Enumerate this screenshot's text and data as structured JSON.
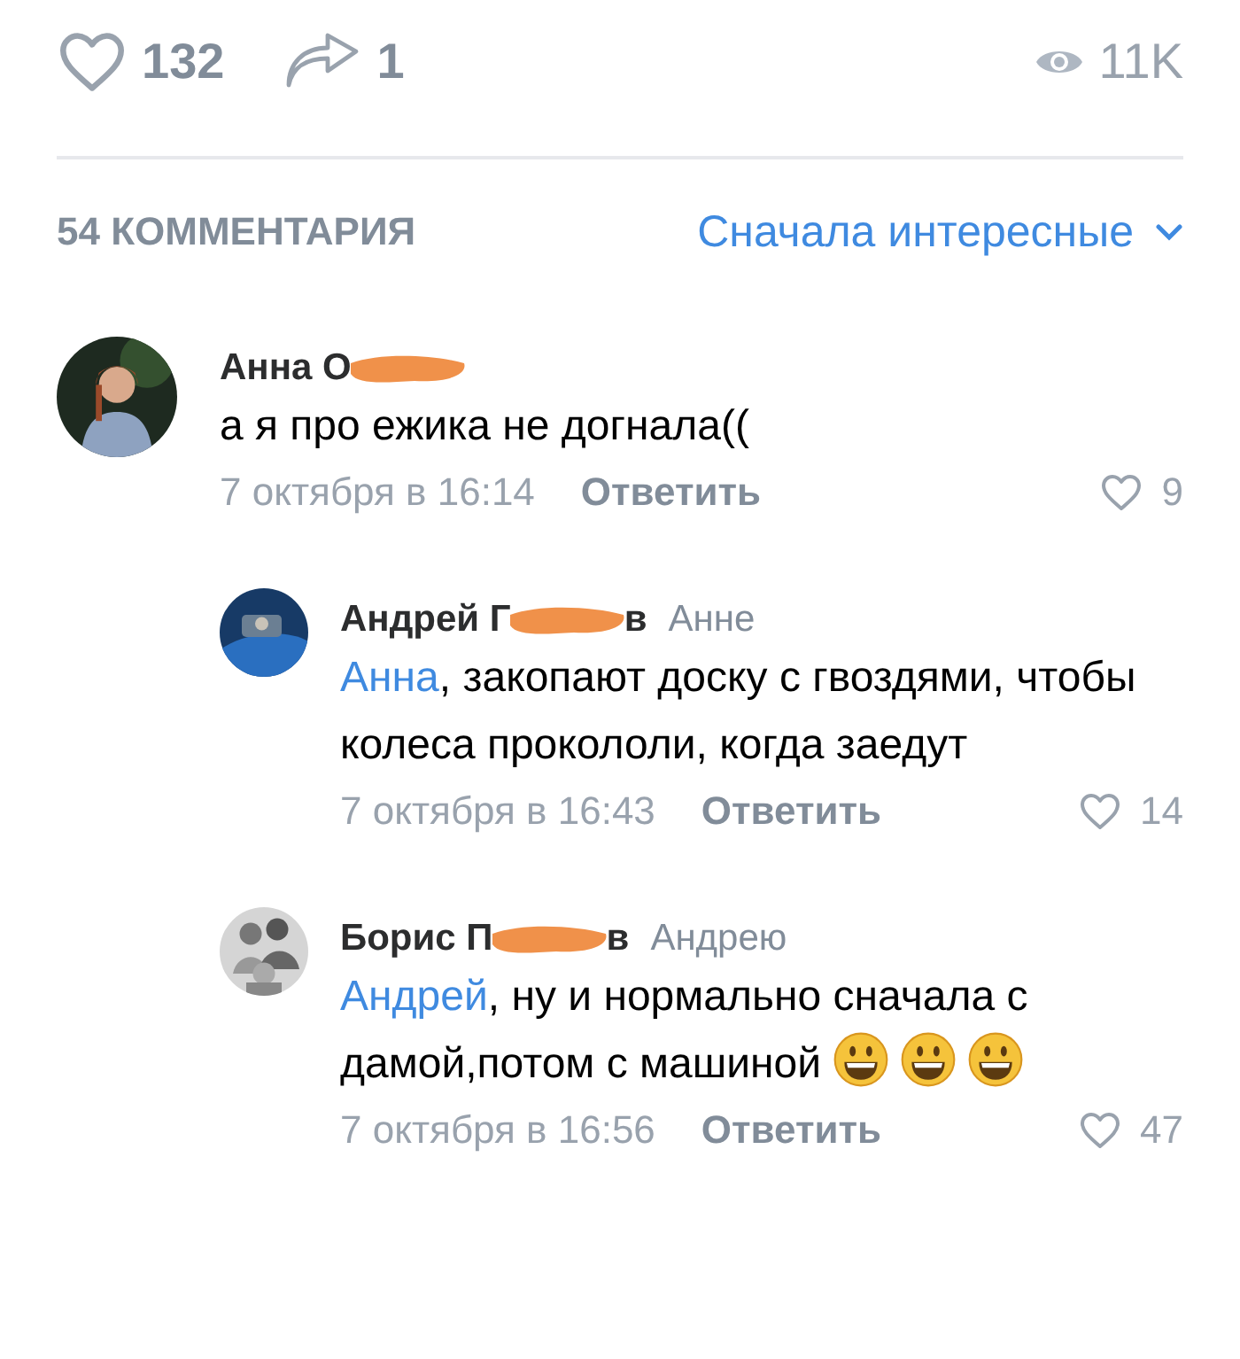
{
  "stats": {
    "likes": "132",
    "shares": "1",
    "views": "11K"
  },
  "comments_header": {
    "count": "54 КОММЕНТАРИЯ",
    "sort": "Сначала интересные"
  },
  "comments": [
    {
      "reply": false,
      "name_parts": [
        "Анна О"
      ],
      "redacted": true,
      "text": "а я про ежика не догнала((",
      "date": "7 октября в 16:14",
      "reply_label": "Ответить",
      "likes": "9"
    },
    {
      "reply": true,
      "name_parts": [
        "Андрей Г",
        "в"
      ],
      "redacted": true,
      "addressee": "Анне",
      "mention": "Анна",
      "text": ", закопают доску с гвоздями, чтобы колеса прокололи, когда заедут",
      "date": "7 октября в 16:43",
      "reply_label": "Ответить",
      "likes": "14"
    },
    {
      "reply": true,
      "name_parts": [
        "Борис П",
        "в"
      ],
      "redacted": true,
      "addressee": "Андрею",
      "mention": "Андрей",
      "text": ", ну и нормально сначала с дамой,потом с машиной",
      "emojis": [
        {
          "kind": "smile"
        },
        {
          "kind": "smile"
        },
        {
          "kind": "smile"
        }
      ],
      "date": "7 октября в 16:56",
      "reply_label": "Ответить",
      "likes": "47"
    }
  ]
}
